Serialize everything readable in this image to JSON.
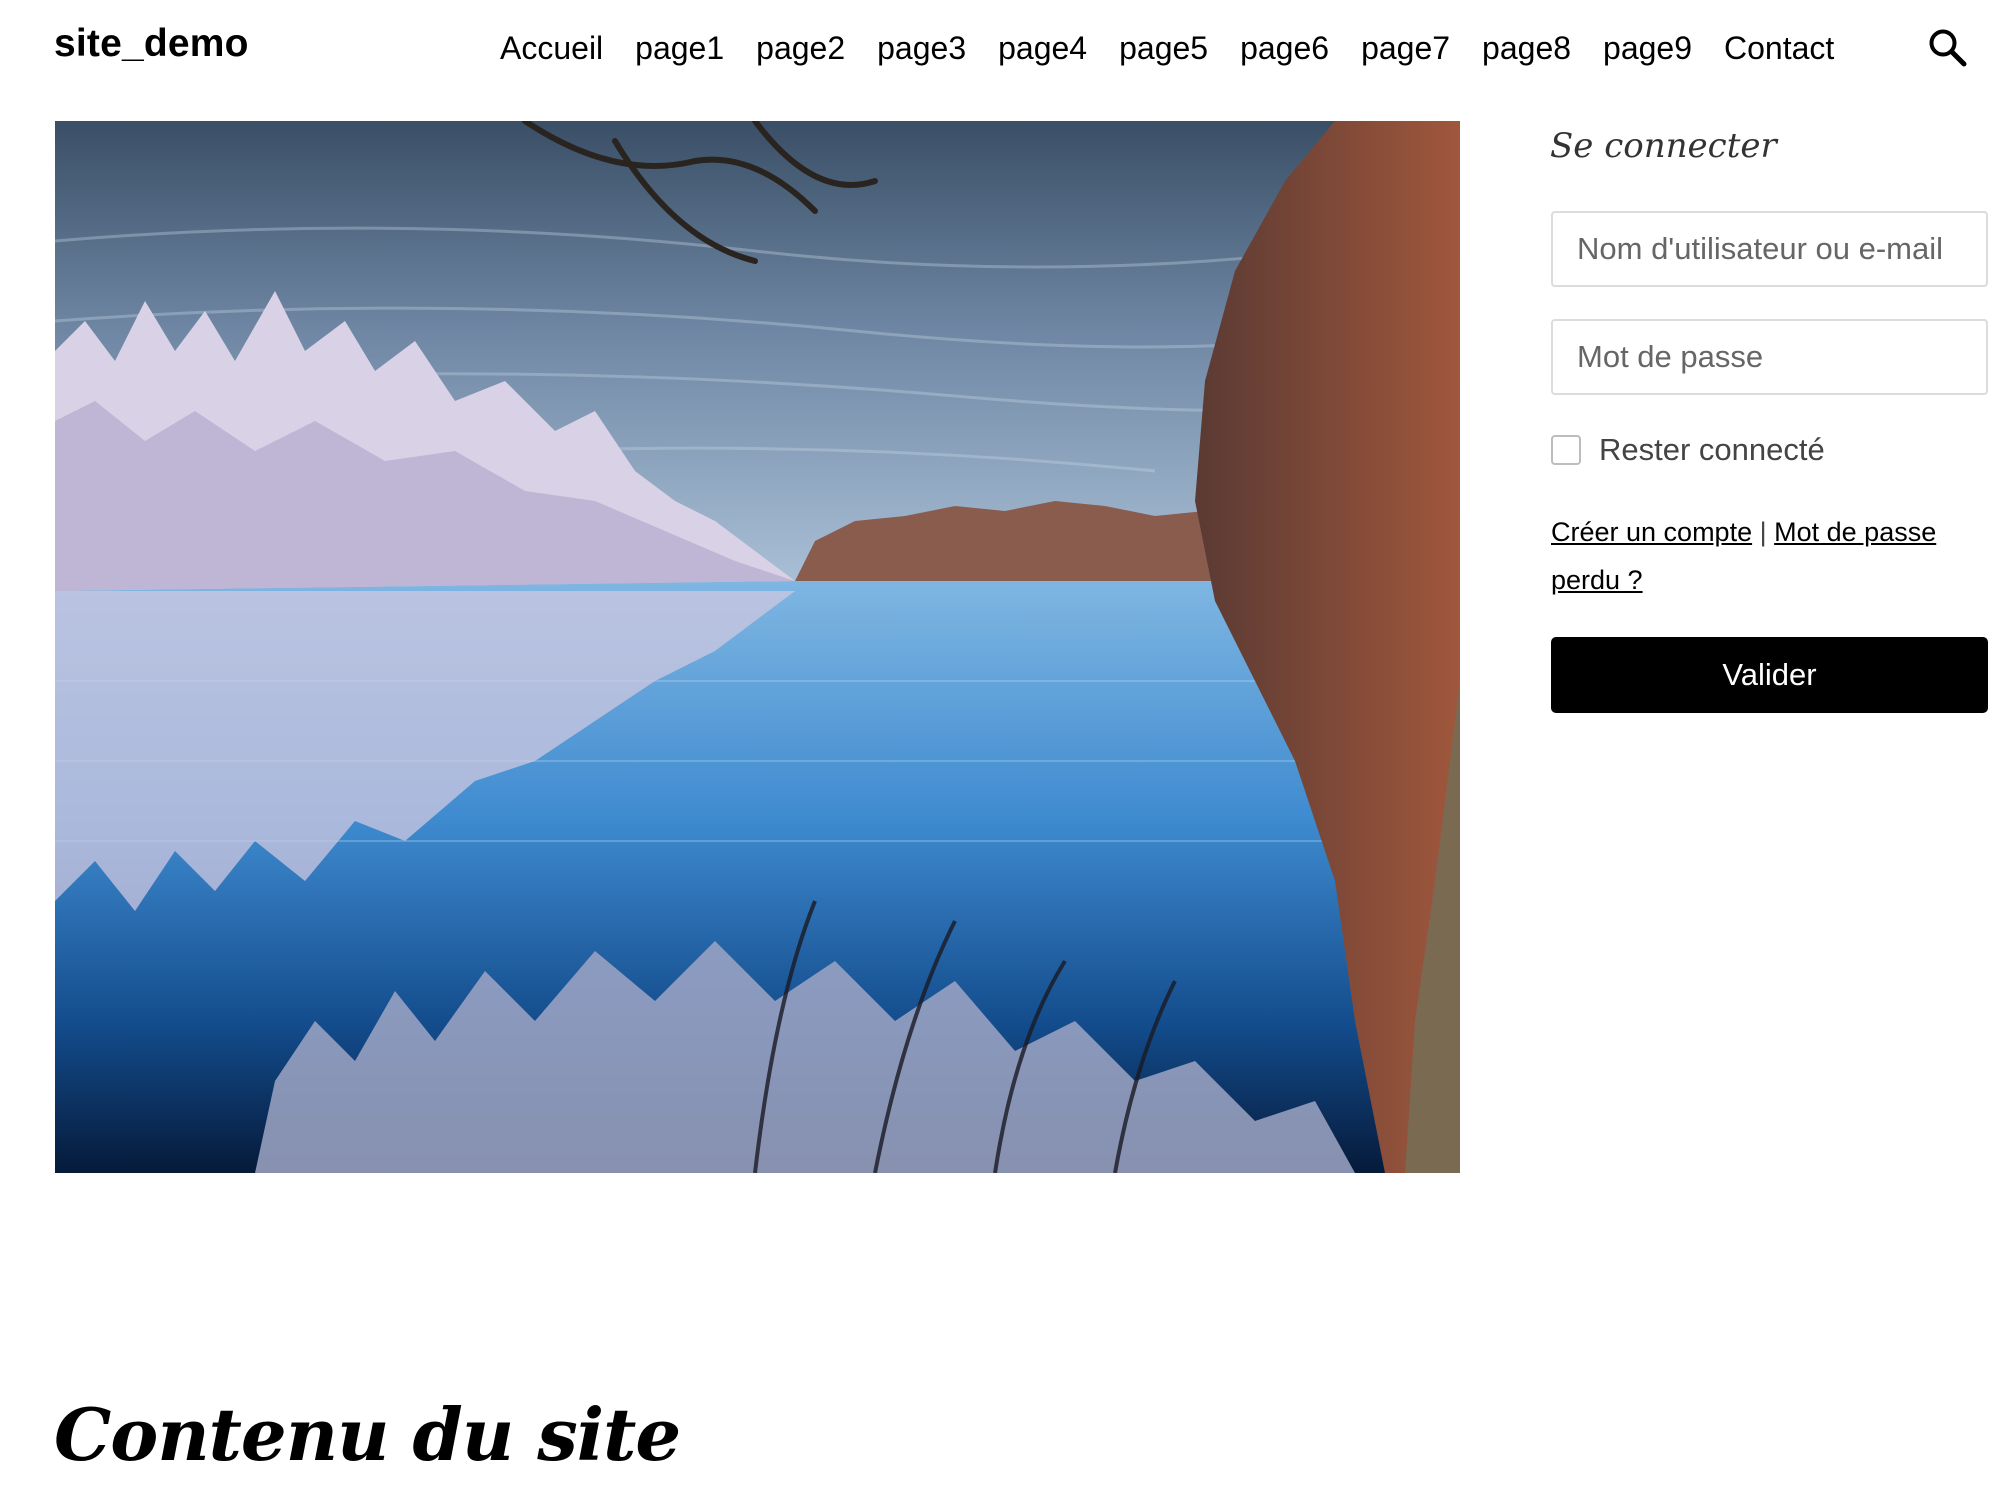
{
  "header": {
    "site_title": "site_demo",
    "nav": [
      {
        "label": "Accueil"
      },
      {
        "label": "page1"
      },
      {
        "label": "page2"
      },
      {
        "label": "page3"
      },
      {
        "label": "page4"
      },
      {
        "label": "page5"
      },
      {
        "label": "page6"
      },
      {
        "label": "page7"
      },
      {
        "label": "page8"
      },
      {
        "label": "page9"
      },
      {
        "label": "Contact"
      }
    ],
    "search_icon": "search-icon"
  },
  "hero": {
    "image": "lake-landscape-infrared-photo"
  },
  "login": {
    "heading": "Se connecter",
    "username_placeholder": "Nom d'utilisateur ou e-mail",
    "password_placeholder": "Mot de passe",
    "remember_label": "Rester connecté",
    "remember_checked": false,
    "create_account": "Créer un compte",
    "separator": "|",
    "lost_password": "Mot de passe perdu ?",
    "submit": "Valider"
  },
  "content": {
    "title": "Contenu du site"
  },
  "colors": {
    "text": "#000000",
    "button_bg": "#000000",
    "button_text": "#ffffff",
    "input_border": "#dcdcdc"
  }
}
